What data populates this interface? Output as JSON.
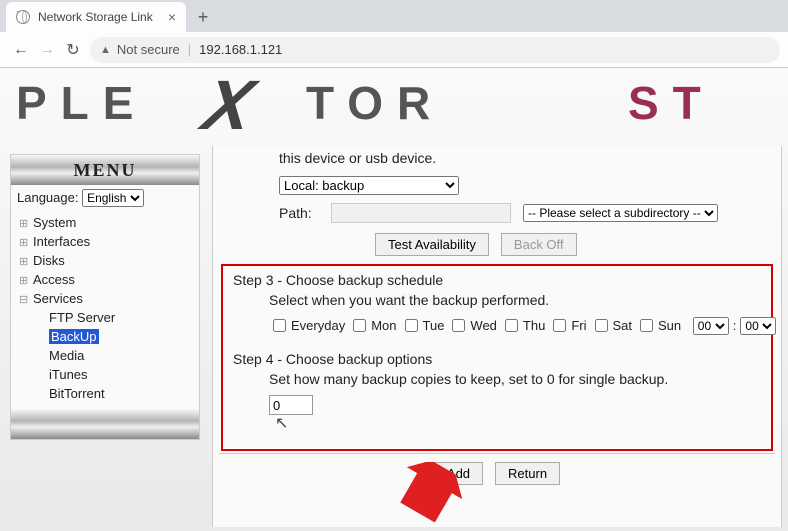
{
  "tab": {
    "title": "Network Storage Link"
  },
  "address": {
    "not_secure": "Not secure",
    "url": "192.168.1.121"
  },
  "brand": {
    "text1": "PLE",
    "text2": "TOR",
    "text3": "ST",
    "x": "X"
  },
  "sidebar": {
    "menu": "MENU",
    "language_label": "Language:",
    "language_value": "English",
    "items": [
      "System",
      "Interfaces",
      "Disks",
      "Access",
      "Services"
    ],
    "services": [
      "FTP Server",
      "BackUp",
      "Media",
      "iTunes",
      "BitTorrent"
    ]
  },
  "step2": {
    "trail": "this device or usb device.",
    "source_value": "Local: backup",
    "path_label": "Path:",
    "path_placeholder": "-- Please select a subdirectory --",
    "test_btn": "Test Availability",
    "back_btn": "Back Off"
  },
  "step3": {
    "title": "Step 3 - Choose backup schedule",
    "desc": "Select when you want the backup performed.",
    "days": [
      "Everyday",
      "Mon",
      "Tue",
      "Wed",
      "Thu",
      "Fri",
      "Sat",
      "Sun"
    ],
    "hour": "00",
    "minute": "00"
  },
  "step4": {
    "title": "Step 4 - Choose backup options",
    "desc": "Set how many backup copies to keep, set to 0 for single backup.",
    "copies": "0"
  },
  "buttons": {
    "add": "Add",
    "return": "Return"
  }
}
